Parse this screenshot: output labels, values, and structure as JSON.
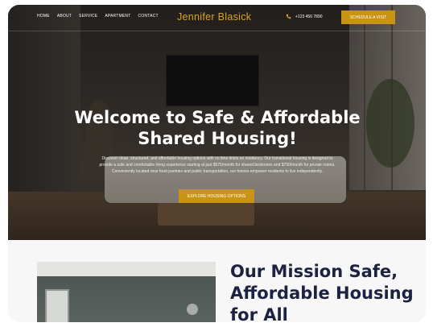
{
  "nav": {
    "links": [
      "HOME",
      "ABOUT",
      "SERVICE",
      "APARTMENT",
      "CONTACT"
    ],
    "brand": "Jennifer Blasick",
    "phone": "+123 456 7890",
    "cta": "SCHEDULE A VISIT"
  },
  "hero": {
    "title": "Welcome to Safe & Affordable Shared Housing!",
    "description": "Discover clean, structured, and affordable housing options with no time limits on residency. Our transitional housing is designed to provide a safe and comfortable living experience starting at just $575/month for shared bedrooms and $750/month for private rooms. Conveniently located near food pantries and public transportation, our homes empower residents to live independently.",
    "button": "EXPLORE HOUSING OPTIONS"
  },
  "mission": {
    "title": "Our Mission Safe, Affordable Housing for All"
  },
  "colors": {
    "accent": "#c99413",
    "brand": "#d9a426",
    "heading_dark": "#1c2240"
  },
  "icons": {
    "phone": "phone-icon"
  }
}
